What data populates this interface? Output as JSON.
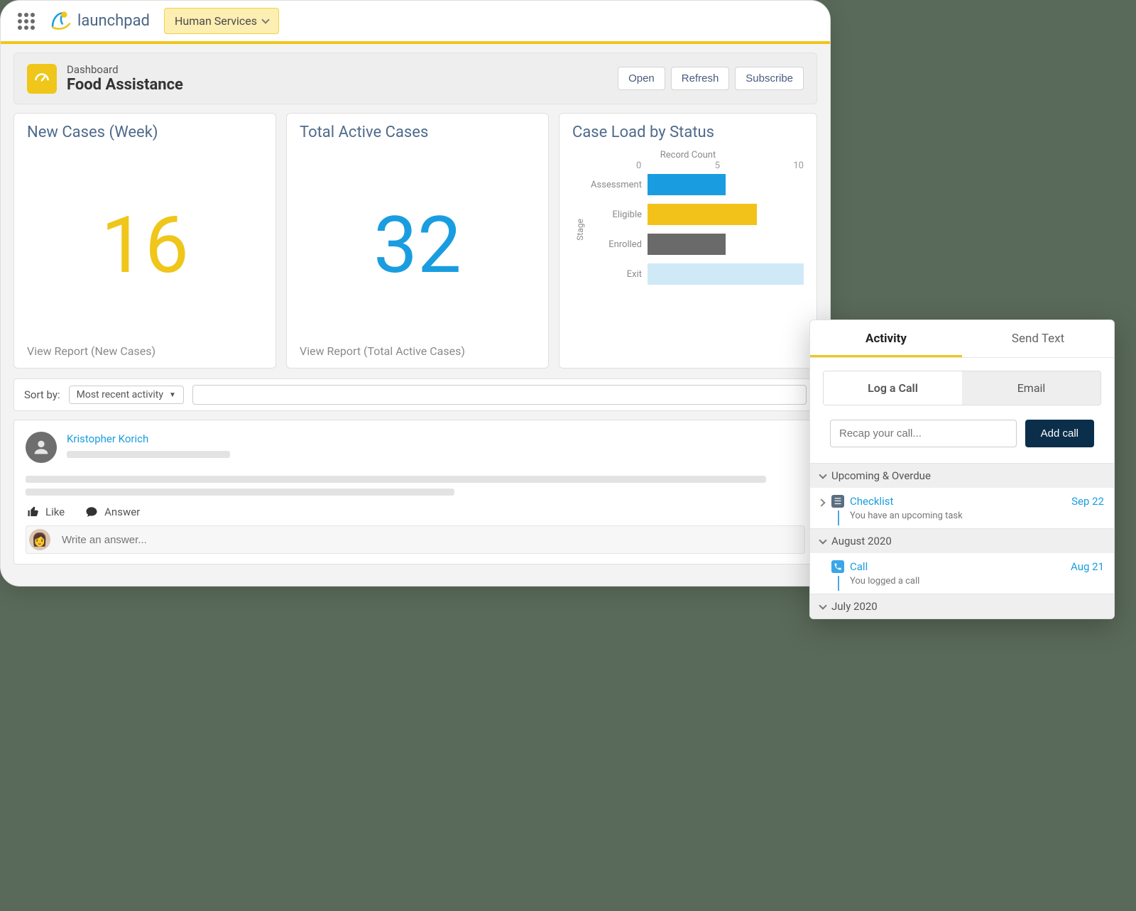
{
  "nav": {
    "brand": "launchpad",
    "context_label": "Human Services"
  },
  "header": {
    "type_label": "Dashboard",
    "title": "Food Assistance",
    "buttons": {
      "open": "Open",
      "refresh": "Refresh",
      "subscribe": "Subscribe"
    }
  },
  "cards": {
    "new_cases": {
      "title": "New Cases (Week)",
      "value": "16",
      "view": "View Report (New Cases)"
    },
    "active_cases": {
      "title": "Total Active Cases",
      "value": "32",
      "view": "View Report (Total Active Cases)"
    },
    "case_load": {
      "title": "Case Load by Status",
      "axis_title": "Record Count",
      "ylabel": "Stage",
      "ticks": [
        "0",
        "5",
        "10"
      ]
    }
  },
  "sort": {
    "label": "Sort by:",
    "selected": "Most recent activity"
  },
  "feed": {
    "author": "Kristopher Korich",
    "like": "Like",
    "answer": "Answer",
    "answer_placeholder": "Write an answer..."
  },
  "activity": {
    "tabs": {
      "activity": "Activity",
      "send_text": "Send Text"
    },
    "subtabs": {
      "log_call": "Log a Call",
      "email": "Email"
    },
    "recap_placeholder": "Recap your call...",
    "add_call": "Add call",
    "sections": {
      "upcoming": {
        "title": "Upcoming & Overdue",
        "entry": {
          "label": "Checklist",
          "date": "Sep 22",
          "sub": "You have an upcoming task"
        }
      },
      "aug": {
        "title": "August 2020",
        "entry": {
          "label": "Call",
          "date": "Aug 21",
          "sub": "You logged a call"
        }
      },
      "jul": {
        "title": "July 2020"
      }
    }
  },
  "chart_data": {
    "type": "bar",
    "orientation": "horizontal",
    "title": "Case Load by Status",
    "xlabel": "Record Count",
    "ylabel": "Stage",
    "xlim": [
      0,
      10
    ],
    "x_ticks": [
      0,
      5,
      10
    ],
    "categories": [
      "Assessment",
      "Eligible",
      "Enrolled",
      "Exit"
    ],
    "values": [
      5,
      7,
      5,
      10
    ],
    "colors": [
      "#1a9de0",
      "#f2c21a",
      "#6a6a6a",
      "#cfe9f7"
    ]
  }
}
